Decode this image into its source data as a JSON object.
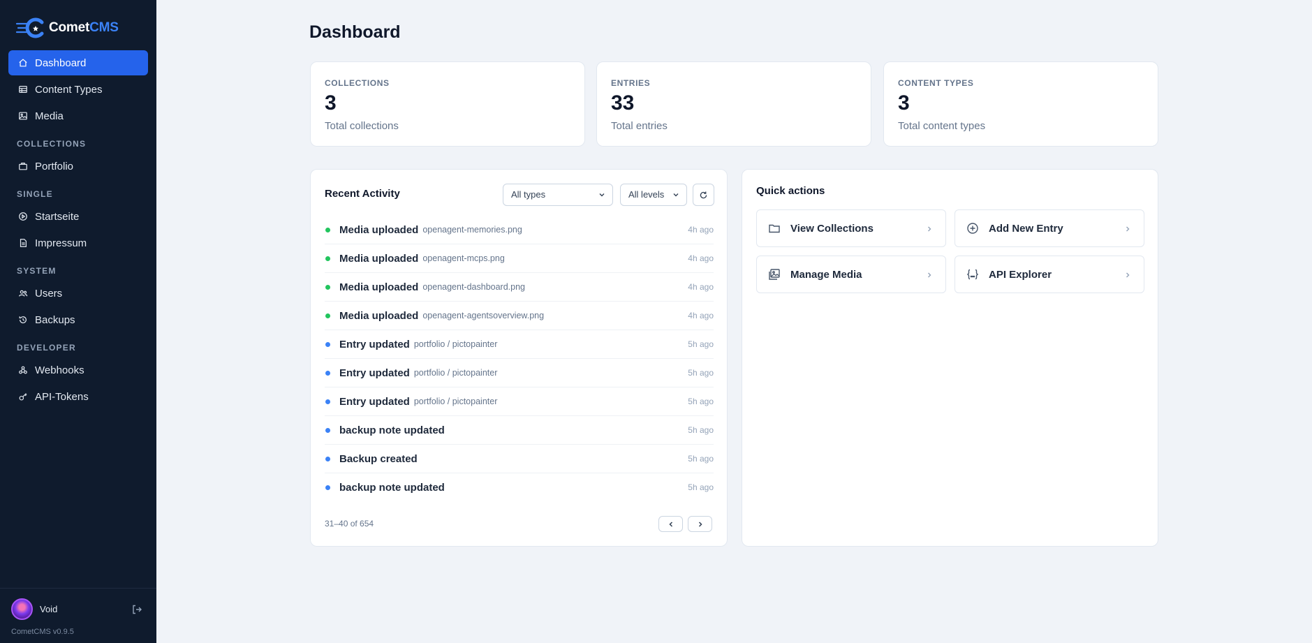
{
  "brand": {
    "name_prefix": "Comet",
    "name_suffix": "CMS"
  },
  "sidebar": {
    "top_items": [
      {
        "label": "Dashboard",
        "icon": "home-icon",
        "active": true
      },
      {
        "label": "Content Types",
        "icon": "table-icon"
      },
      {
        "label": "Media",
        "icon": "image-icon"
      }
    ],
    "sections": [
      {
        "title": "COLLECTIONS",
        "items": [
          {
            "label": "Portfolio",
            "icon": "briefcase-icon"
          }
        ]
      },
      {
        "title": "SINGLE",
        "items": [
          {
            "label": "Startseite",
            "icon": "play-circle-icon"
          },
          {
            "label": "Impressum",
            "icon": "document-icon"
          }
        ]
      },
      {
        "title": "SYSTEM",
        "items": [
          {
            "label": "Users",
            "icon": "users-icon"
          },
          {
            "label": "Backups",
            "icon": "history-icon"
          }
        ]
      },
      {
        "title": "DEVELOPER",
        "items": [
          {
            "label": "Webhooks",
            "icon": "webhook-icon"
          },
          {
            "label": "API-Tokens",
            "icon": "key-icon"
          }
        ]
      }
    ],
    "user": {
      "name": "Void"
    },
    "version": "CometCMS v0.9.5"
  },
  "page": {
    "title": "Dashboard"
  },
  "stats": [
    {
      "label": "COLLECTIONS",
      "value": "3",
      "sub": "Total collections"
    },
    {
      "label": "ENTRIES",
      "value": "33",
      "sub": "Total entries"
    },
    {
      "label": "CONTENT TYPES",
      "value": "3",
      "sub": "Total content types"
    }
  ],
  "activity": {
    "title": "Recent Activity",
    "type_filter": "All types",
    "level_filter": "All levels",
    "items": [
      {
        "title": "Media uploaded",
        "detail": "openagent-memories.png",
        "time": "4h ago",
        "status": "green"
      },
      {
        "title": "Media uploaded",
        "detail": "openagent-mcps.png",
        "time": "4h ago",
        "status": "green"
      },
      {
        "title": "Media uploaded",
        "detail": "openagent-dashboard.png",
        "time": "4h ago",
        "status": "green"
      },
      {
        "title": "Media uploaded",
        "detail": "openagent-agentsoverview.png",
        "time": "4h ago",
        "status": "green"
      },
      {
        "title": "Entry updated",
        "detail": "portfolio / pictopainter",
        "time": "5h ago",
        "status": "blue"
      },
      {
        "title": "Entry updated",
        "detail": "portfolio / pictopainter",
        "time": "5h ago",
        "status": "blue"
      },
      {
        "title": "Entry updated",
        "detail": "portfolio / pictopainter",
        "time": "5h ago",
        "status": "blue"
      },
      {
        "title": "backup note updated",
        "detail": "",
        "time": "5h ago",
        "status": "blue"
      },
      {
        "title": "Backup created",
        "detail": "",
        "time": "5h ago",
        "status": "blue"
      },
      {
        "title": "backup note updated",
        "detail": "",
        "time": "5h ago",
        "status": "blue"
      }
    ],
    "pagination": "31–40 of 654"
  },
  "quick_actions": {
    "title": "Quick actions",
    "items": [
      {
        "label": "View Collections",
        "icon": "folder-icon"
      },
      {
        "label": "Add New Entry",
        "icon": "plus-circle-icon"
      },
      {
        "label": "Manage Media",
        "icon": "images-icon"
      },
      {
        "label": "API Explorer",
        "icon": "braces-icon"
      }
    ]
  },
  "colors": {
    "sidebar_bg": "#0f1b2d",
    "accent": "#2563eb",
    "success": "#22c55e",
    "info": "#3b82f6",
    "page_bg": "#f0f3f8"
  }
}
